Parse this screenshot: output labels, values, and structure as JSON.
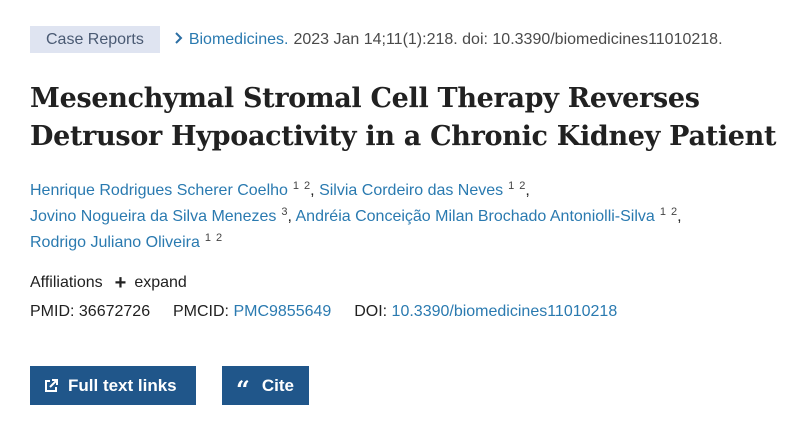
{
  "header": {
    "badge": "Case Reports",
    "journal": "Biomedicines.",
    "citation": "2023 Jan 14;11(1):218. doi: 10.3390/biomedicines11010218."
  },
  "title_line1": "Mesenchymal Stromal Cell Therapy Reverses",
  "title_line2": "Detrusor Hypoactivity in a Chronic Kidney Patient",
  "authors": [
    {
      "name": "Henrique Rodrigues Scherer Coelho",
      "sup1": "1",
      "sup2": "2"
    },
    {
      "name": "Silvia Cordeiro das Neves",
      "sup1": "1",
      "sup2": "2"
    },
    {
      "name": "Jovino Nogueira da Silva Menezes",
      "sup1": "3"
    },
    {
      "name": "Andréia Conceição Milan Brochado Antoniolli-Silva",
      "sup1": "1",
      "sup2": "2"
    },
    {
      "name": "Rodrigo Juliano Oliveira",
      "sup1": "1",
      "sup2": "2"
    }
  ],
  "affiliations": {
    "label": "Affiliations",
    "plus": "+",
    "expand": "expand"
  },
  "ids": {
    "pmid_label": "PMID:",
    "pmid": "36672726",
    "pmcid_label": "PMCID:",
    "pmcid": "PMC9855649",
    "doi_label": "DOI:",
    "doi": "10.3390/biomedicines11010218"
  },
  "buttons": {
    "full_text": "Full text links",
    "cite_icon": "“",
    "cite": "Cite"
  },
  "separators": {
    "comma": ","
  },
  "icons": {
    "chevron": "chevron-right-icon",
    "external": "external-link-icon",
    "quote": "quote-icon"
  },
  "colors": {
    "link": "#2a7ab0",
    "button": "#20568a",
    "badge_bg": "#dfe4f1"
  }
}
